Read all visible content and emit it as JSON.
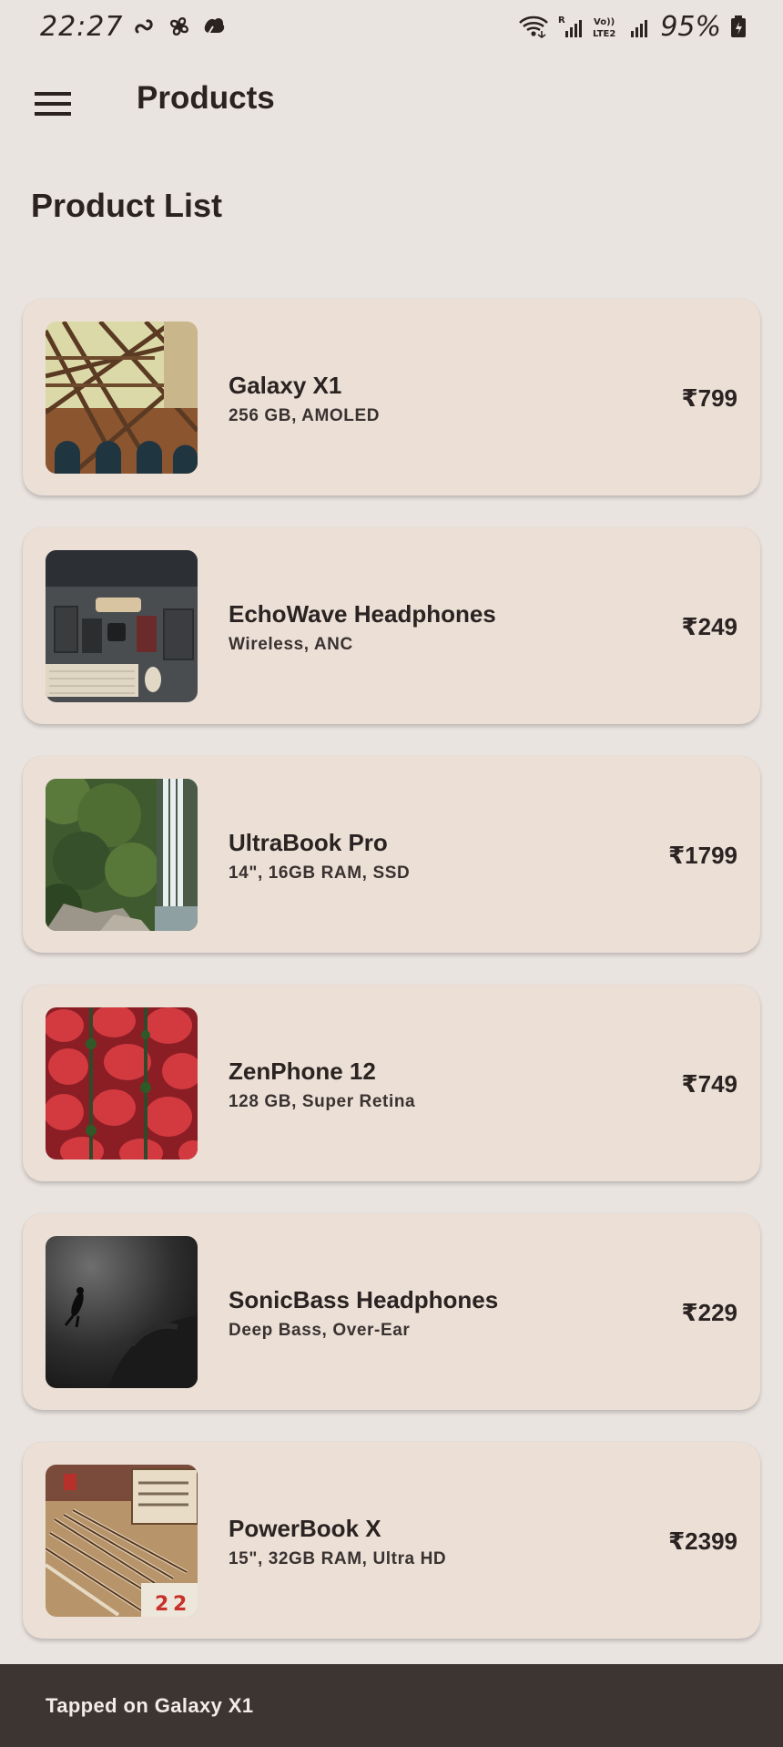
{
  "status_bar": {
    "time": "22:27",
    "battery": "95%",
    "network_labels": [
      "R",
      "Vo)) LTE2"
    ]
  },
  "app_bar": {
    "menu_icon": "hamburger-menu-icon",
    "title": "Products"
  },
  "section_title": "Product List",
  "products": [
    {
      "name": "Galaxy X1",
      "desc": "256 GB, AMOLED",
      "price": "₹799",
      "image": "architecture-photo"
    },
    {
      "name": "EchoWave Headphones",
      "desc": "Wireless, ANC",
      "price": "₹249",
      "image": "desk-setup-photo"
    },
    {
      "name": "UltraBook Pro",
      "desc": "14\", 16GB RAM, SSD",
      "price": "₹1799",
      "image": "waterfall-photo"
    },
    {
      "name": "ZenPhone 12",
      "desc": "128 GB, Super Retina",
      "price": "₹749",
      "image": "strawberries-photo"
    },
    {
      "name": "SonicBass Headphones",
      "desc": "Deep Bass, Over-Ear",
      "price": "₹229",
      "image": "diver-photo"
    },
    {
      "name": "PowerBook X",
      "desc": "15\", 32GB RAM, Ultra HD",
      "price": "₹2399",
      "image": "pencils-photo"
    }
  ],
  "snackbar": {
    "message": "Tapped on Galaxy X1"
  },
  "colors": {
    "background": "#EAE4E0",
    "card": "#EBDFD6",
    "text": "#2A2321",
    "snackbar": "#3D3532"
  }
}
